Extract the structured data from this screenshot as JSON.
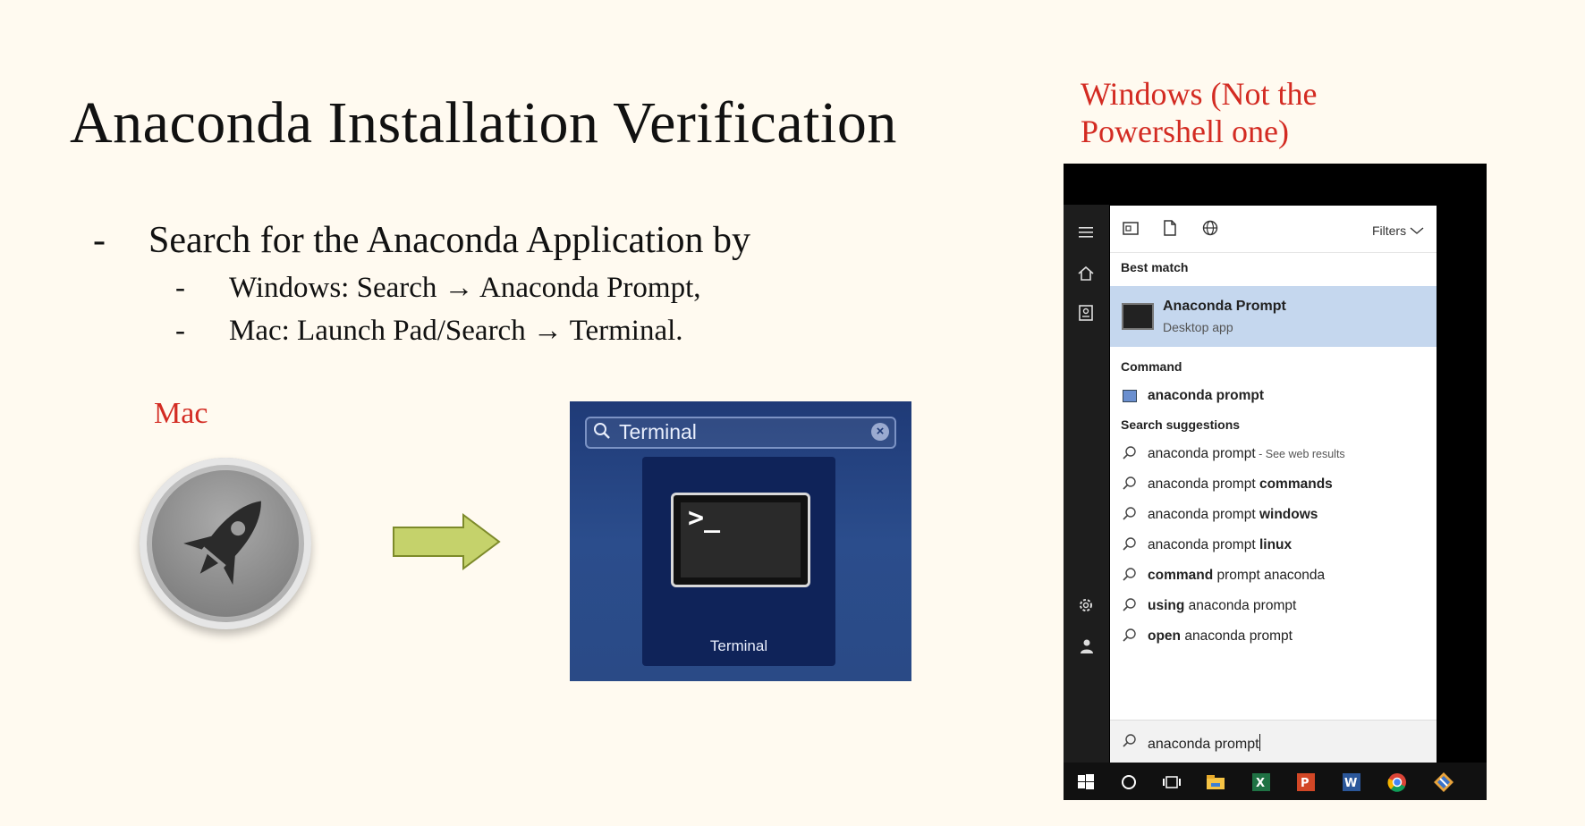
{
  "slide": {
    "title": "Anaconda Installation Verification",
    "bullets": [
      {
        "dash": "-",
        "text": "Search for the Anaconda Application by"
      },
      {
        "dash": "-",
        "text": "Windows: Search →  Anaconda Prompt,"
      },
      {
        "dash": "-",
        "text": "Mac: Launch Pad/Search →  Terminal."
      }
    ],
    "mac_label": "Mac",
    "windows_label_line1": "Windows (Not the",
    "windows_label_line2": "Powershell one)"
  },
  "mac_panel": {
    "search_value": "Terminal",
    "result_label": "Terminal",
    "terminal_prompt": ">_",
    "clear_glyph": "×"
  },
  "windows_panel": {
    "filters_label": "Filters",
    "best_match_header": "Best match",
    "best_match_title": "Anaconda Prompt",
    "best_match_subtitle": "Desktop app",
    "command_header": "Command",
    "command_item": "anaconda prompt",
    "suggestions_header": "Search suggestions",
    "suggestions": [
      {
        "normal": "anaconda prompt",
        "bold": "",
        "hint": " - See web results"
      },
      {
        "normal": "anaconda prompt ",
        "bold": "commands",
        "hint": ""
      },
      {
        "normal": "anaconda prompt ",
        "bold": "windows",
        "hint": ""
      },
      {
        "normal": "anaconda prompt ",
        "bold": "linux",
        "hint": ""
      },
      {
        "normal": " prompt anaconda",
        "bold": "command",
        "hint": "",
        "bold_first": true
      },
      {
        "normal": " anaconda prompt",
        "bold": "using",
        "hint": "",
        "bold_first": true
      },
      {
        "normal": " anaconda prompt",
        "bold": "open",
        "hint": "",
        "bold_first": true
      }
    ],
    "search_value": "anaconda prompt"
  },
  "colors": {
    "background": "#fffaf0",
    "label_red": "#d32b22",
    "arrow_fill": "#c5d26b",
    "mac_panel_blue": "#2b4d8c",
    "win_highlight": "#c5d7ee"
  }
}
